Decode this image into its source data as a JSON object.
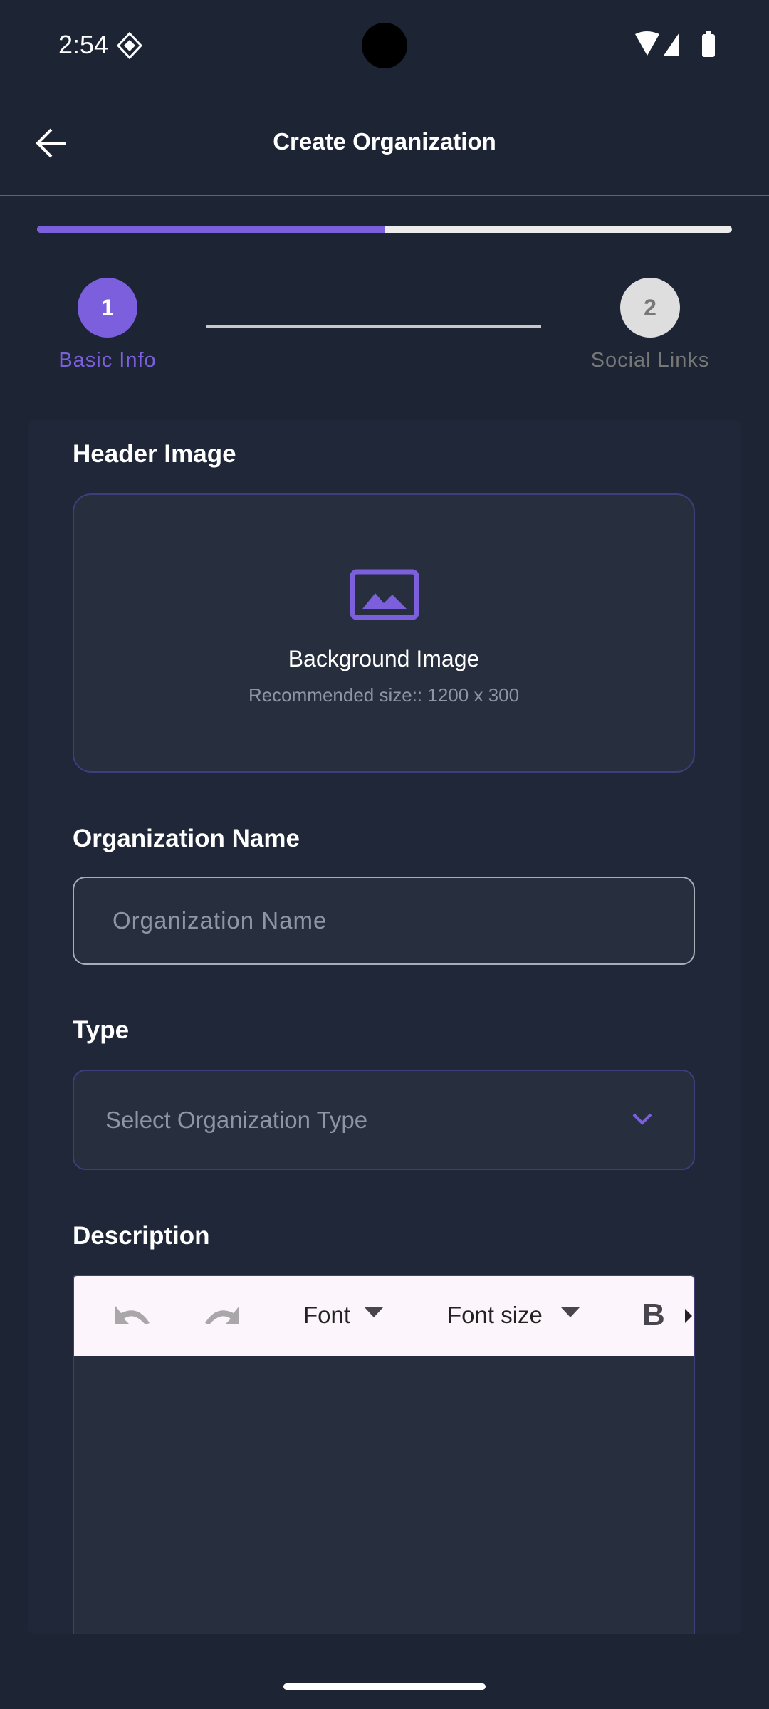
{
  "status_bar": {
    "time": "2:54"
  },
  "app_bar": {
    "title": "Create Organization"
  },
  "progress": {
    "value": 0.5
  },
  "stepper": {
    "steps": [
      {
        "number": "1",
        "label": "Basic Info",
        "active": true
      },
      {
        "number": "2",
        "label": "Social Links",
        "active": false
      }
    ]
  },
  "form": {
    "header_image": {
      "label": "Header Image",
      "title": "Background Image",
      "hint": "Recommended size:: 1200 x 300"
    },
    "org_name": {
      "label": "Organization Name",
      "placeholder": "Organization Name"
    },
    "type": {
      "label": "Type",
      "placeholder": "Select Organization Type"
    },
    "description": {
      "label": "Description",
      "toolbar": {
        "font": "Font",
        "font_size": "Font size",
        "bold": "B"
      }
    }
  },
  "colors": {
    "accent": "#7b5fdc",
    "background": "#1d2535"
  }
}
